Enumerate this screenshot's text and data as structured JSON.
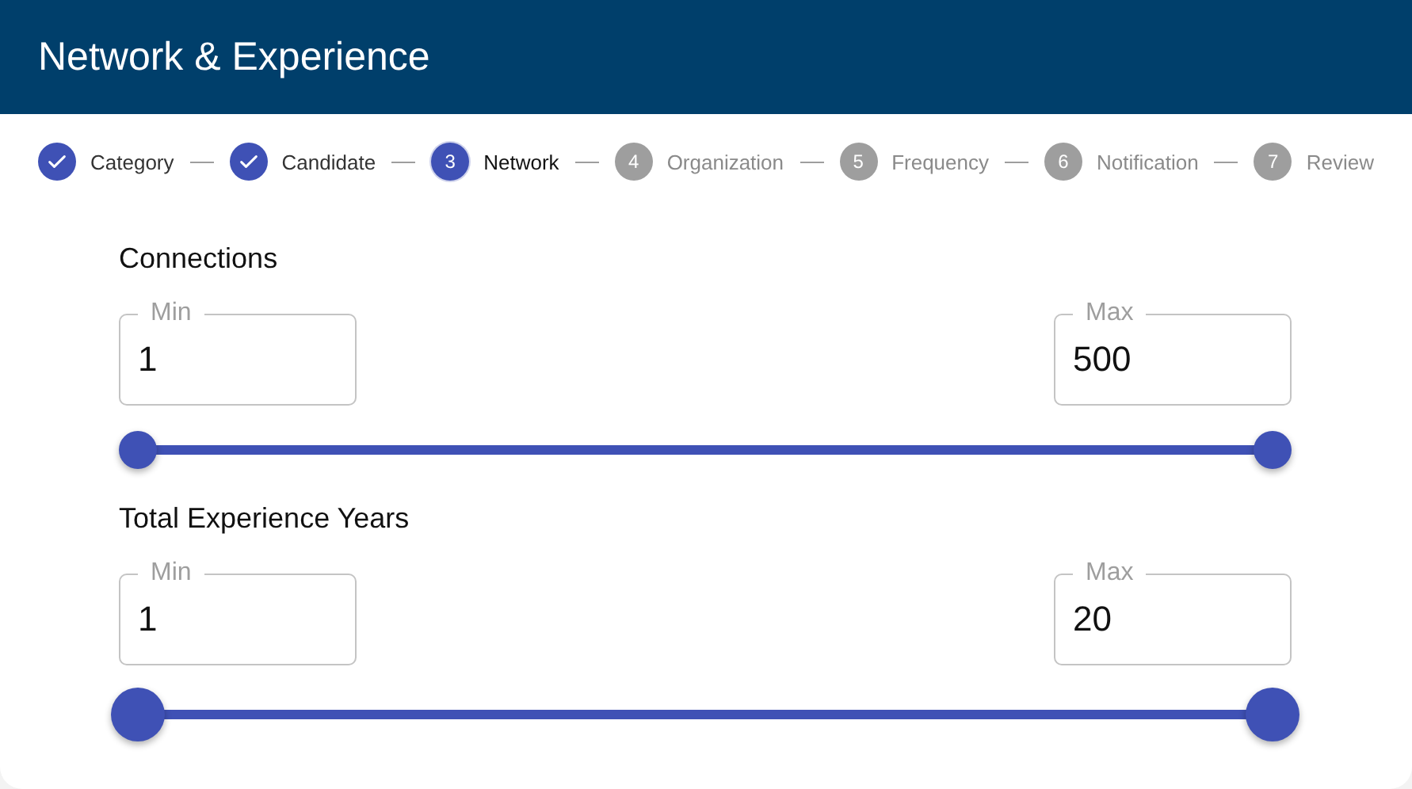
{
  "header": {
    "title": "Network & Experience"
  },
  "steps": [
    {
      "label": "Category",
      "completed": true,
      "selected": false
    },
    {
      "label": "Candidate",
      "completed": true,
      "selected": false
    },
    {
      "number": "3",
      "label": "Network",
      "completed": false,
      "selected": true
    },
    {
      "number": "4",
      "label": "Organization",
      "completed": false,
      "selected": false
    },
    {
      "number": "5",
      "label": "Frequency",
      "completed": false,
      "selected": false
    },
    {
      "number": "6",
      "label": "Notification",
      "completed": false,
      "selected": false
    },
    {
      "number": "7",
      "label": "Review",
      "completed": false,
      "selected": false
    }
  ],
  "ranges": [
    {
      "title": "Connections",
      "min": {
        "label": "Min",
        "value": "1"
      },
      "max": {
        "label": "Max",
        "value": "500"
      },
      "focused": false,
      "thumbs": [
        {
          "level": 0
        },
        {
          "level": 1
        }
      ]
    },
    {
      "title": "Total Experience Years",
      "min": {
        "label": "Min",
        "value": "1"
      },
      "max": {
        "label": "Max",
        "value": "20"
      },
      "focused": true,
      "thumbs": [
        {
          "level": 0
        },
        {
          "level": 1
        }
      ]
    }
  ]
}
